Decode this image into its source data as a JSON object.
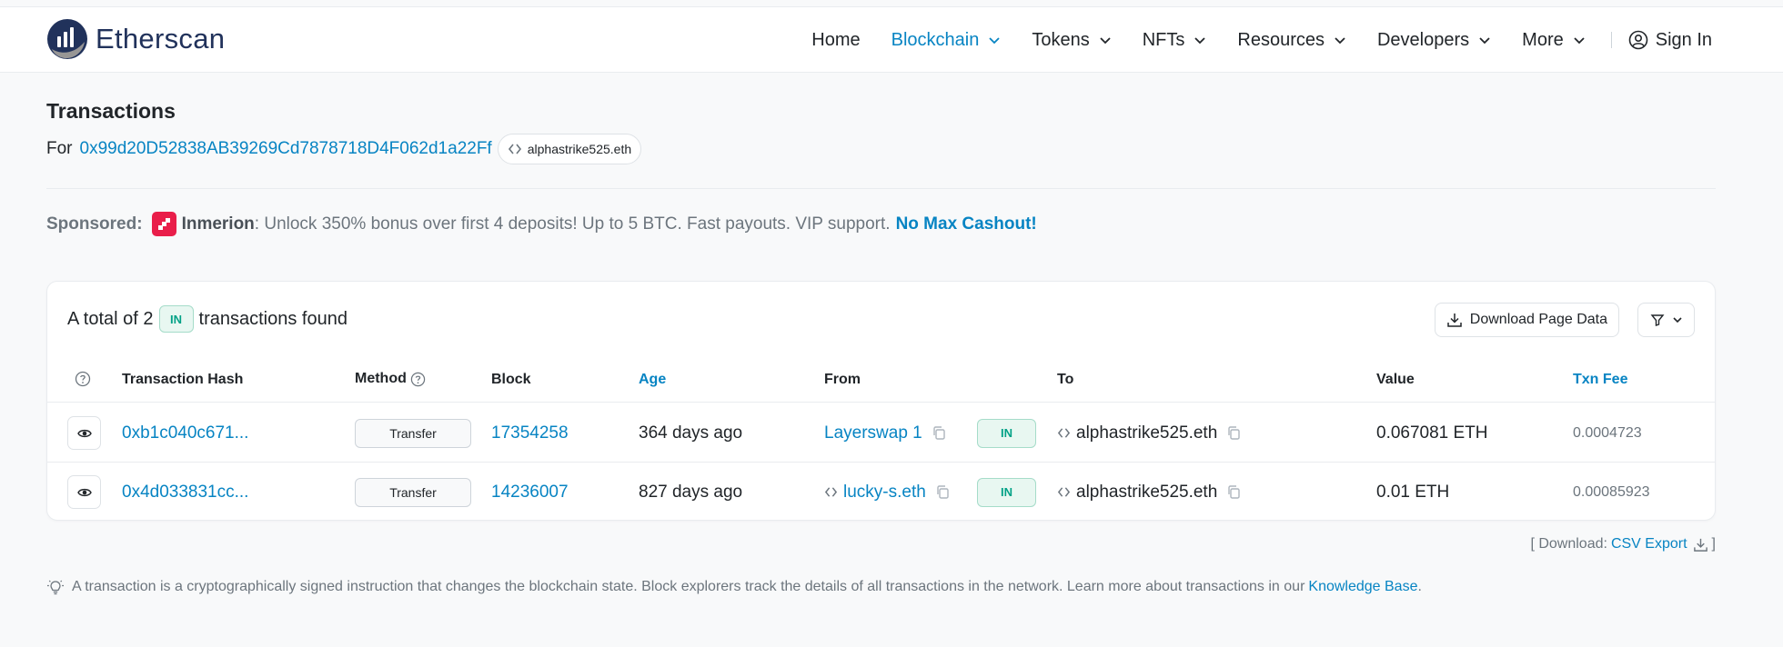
{
  "brand": {
    "name": "Etherscan"
  },
  "nav": {
    "home": "Home",
    "blockchain": "Blockchain",
    "tokens": "Tokens",
    "nfts": "NFTs",
    "resources": "Resources",
    "developers": "Developers",
    "more": "More",
    "signin": "Sign In"
  },
  "page": {
    "title": "Transactions",
    "for_label": "For",
    "address": "0x99d20D52838AB39269Cd7878718D4F062d1a22Ff",
    "ens_name": "alphastrike525.eth"
  },
  "sponsor": {
    "label": "Sponsored:",
    "name": "Inmerion",
    "text": ": Unlock 350% bonus over first 4 deposits! Up to 5 BTC. Fast payouts. VIP support.",
    "cta": "No Max Cashout!",
    "logo_color": "#e91e4a"
  },
  "summary": {
    "prefix": "A total of 2",
    "badge": "IN",
    "suffix": "transactions found",
    "download_label": "Download Page Data"
  },
  "table": {
    "headers": {
      "hash": "Transaction Hash",
      "method": "Method",
      "block": "Block",
      "age": "Age",
      "from": "From",
      "to": "To",
      "value": "Value",
      "fee": "Txn Fee"
    },
    "rows": [
      {
        "hash": "0xb1c040c671...",
        "method": "Transfer",
        "block": "17354258",
        "age": "364 days ago",
        "from": "Layerswap 1",
        "direction": "IN",
        "to": "alphastrike525.eth",
        "value": "0.067081 ETH",
        "fee": "0.0004723"
      },
      {
        "hash": "0x4d033831cc...",
        "method": "Transfer",
        "block": "14236007",
        "age": "827 days ago",
        "from": "lucky-s.eth",
        "direction": "IN",
        "to": "alphastrike525.eth",
        "value": "0.01 ETH",
        "fee": "0.00085923"
      }
    ]
  },
  "footer": {
    "download_prefix": "[ Download:",
    "csv_label": "CSV Export",
    "download_suffix": "]",
    "info_text": "A transaction is a cryptographically signed instruction that changes the blockchain state. Block explorers track the details of all transactions in the network. Learn more about transactions in our",
    "info_link": "Knowledge Base",
    "info_end": "."
  },
  "colors": {
    "accent": "#0784c3",
    "brand": "#21325b",
    "success": "#00a186"
  }
}
